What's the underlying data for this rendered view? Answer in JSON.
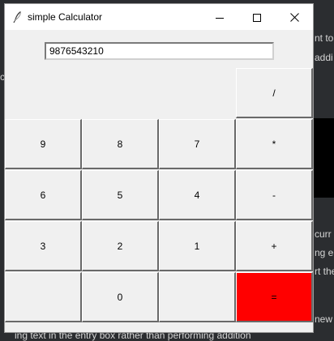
{
  "window": {
    "title": "simple Calculator"
  },
  "entry": {
    "value": "9876543210"
  },
  "buttons": {
    "divide": "/",
    "b9": "9",
    "b8": "8",
    "b7": "7",
    "multiply": "*",
    "b6": "6",
    "b5": "5",
    "b4": "4",
    "subtract": "-",
    "b3": "3",
    "b2": "2",
    "b1": "1",
    "add": "+",
    "b0": "0",
    "equals": "="
  },
  "colors": {
    "equals_bg": "#ff0000",
    "window_bg": "#f0f0f0"
  },
  "icons": {
    "app": "feather-icon",
    "minimize": "minimize-icon",
    "maximize": "maximize-icon",
    "close": "close-icon"
  },
  "background_text": {
    "line_1": "nt to",
    "line_2": "addi",
    "line_3": "c",
    "line_4": "curr",
    "line_5": "ng e",
    "line_6": "rt the",
    "line_7": "new",
    "line_8": "ing text in the entry box rather than performing addition"
  }
}
